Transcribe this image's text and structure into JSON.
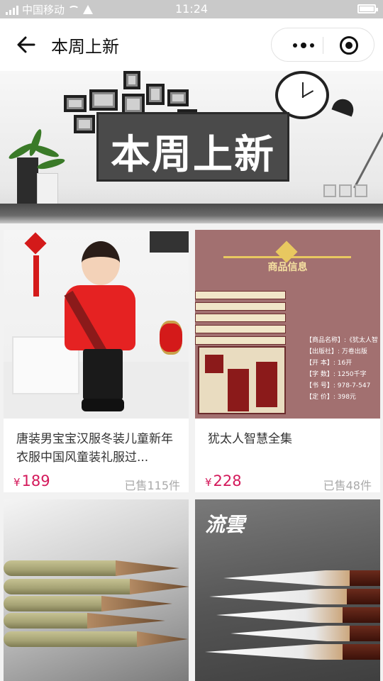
{
  "status_bar": {
    "carrier": "中国移动",
    "time": "11:24"
  },
  "nav": {
    "title": "本周上新",
    "back_icon": "arrow-left-icon",
    "more_icon": "more-dots-icon",
    "close_icon": "target-icon"
  },
  "banner": {
    "title": "本周上新"
  },
  "products": [
    {
      "name": "唐装男宝宝汉服冬装儿童新年衣服中国风童装礼服过...",
      "currency": "¥",
      "price": "189",
      "sold": "已售115件"
    },
    {
      "name": "犹太人智慧全集",
      "currency": "¥",
      "price": "228",
      "sold": "已售48件",
      "image_text": {
        "heading": "商品信息",
        "lines": [
          "【商品名称】:《犹太人智",
          "【出版社】: 万卷出版",
          "【开 本】: 16开",
          "【字 数】: 1250千字",
          "【书 号】: 978-7-547",
          "【定 价】: 398元"
        ]
      }
    },
    {
      "name": "",
      "currency": "",
      "price": "",
      "sold": ""
    },
    {
      "name": "",
      "currency": "",
      "price": "",
      "sold": "",
      "image_text": {
        "brand": "流雲"
      }
    }
  ],
  "colors": {
    "price": "#d4195b",
    "status_bar_bg": "#c9c9c9",
    "page_bg": "#f2f2f2"
  }
}
